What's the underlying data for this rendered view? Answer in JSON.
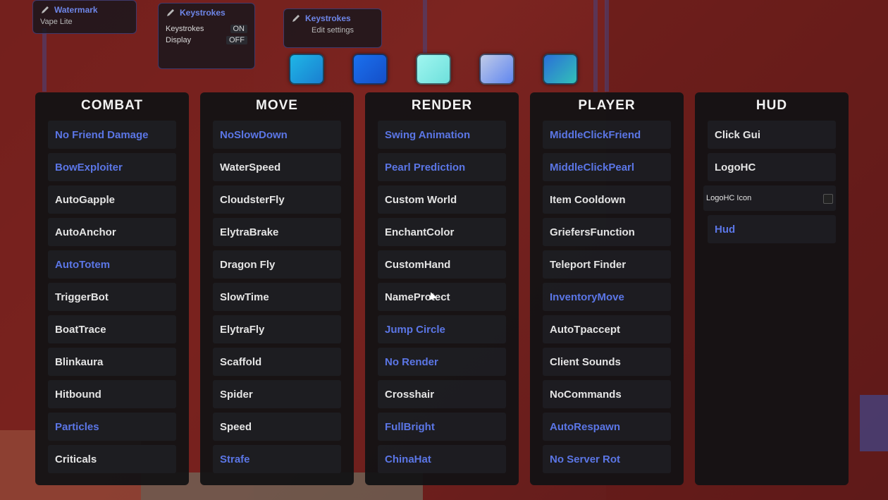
{
  "widgets": [
    {
      "title": "Watermark",
      "subtitle": "Vape Lite"
    },
    {
      "title": "Keystrokes",
      "rows": [
        {
          "label": "Keystrokes",
          "value": "ON"
        },
        {
          "label": "Display",
          "value": "OFF"
        }
      ]
    },
    {
      "title": "Keystrokes",
      "subtitle": "Edit settings"
    }
  ],
  "swatches": [
    {
      "name": "cyan-blue",
      "color": "#1f9fd9"
    },
    {
      "name": "blue",
      "color": "#1a5fe0"
    },
    {
      "name": "aqua",
      "color": "#8ff0ea"
    },
    {
      "name": "periwinkle",
      "color": "#7f9ff0"
    },
    {
      "name": "teal-blue",
      "color": "#2a8fc8"
    }
  ],
  "panels": [
    {
      "title": "COMBAT",
      "modules": [
        {
          "label": "No Friend Damage",
          "on": true
        },
        {
          "label": "BowExploiter",
          "on": true
        },
        {
          "label": "AutoGapple",
          "on": false
        },
        {
          "label": "AutoAnchor",
          "on": false
        },
        {
          "label": "AutoTotem",
          "on": true
        },
        {
          "label": "TriggerBot",
          "on": false
        },
        {
          "label": "BoatTrace",
          "on": false
        },
        {
          "label": "Blinkaura",
          "on": false
        },
        {
          "label": "Hitbound",
          "on": false
        },
        {
          "label": "Particles",
          "on": true
        },
        {
          "label": "Criticals",
          "on": false
        }
      ]
    },
    {
      "title": "MOVE",
      "modules": [
        {
          "label": "NoSlowDown",
          "on": true
        },
        {
          "label": "WaterSpeed",
          "on": false
        },
        {
          "label": "CloudsterFly",
          "on": false
        },
        {
          "label": "ElytraBrake",
          "on": false
        },
        {
          "label": "Dragon Fly",
          "on": false
        },
        {
          "label": "SlowTime",
          "on": false
        },
        {
          "label": "ElytraFly",
          "on": false
        },
        {
          "label": "Scaffold",
          "on": false
        },
        {
          "label": "Spider",
          "on": false
        },
        {
          "label": "Speed",
          "on": false
        },
        {
          "label": "Strafe",
          "on": true
        }
      ]
    },
    {
      "title": "RENDER",
      "modules": [
        {
          "label": "Swing Animation",
          "on": true
        },
        {
          "label": "Pearl Prediction",
          "on": true
        },
        {
          "label": "Custom World",
          "on": false
        },
        {
          "label": "EnchantColor",
          "on": false
        },
        {
          "label": "CustomHand",
          "on": false
        },
        {
          "label": "NameProtect",
          "on": false
        },
        {
          "label": "Jump Circle",
          "on": true
        },
        {
          "label": "No Render",
          "on": true
        },
        {
          "label": "Crosshair",
          "on": false
        },
        {
          "label": "FullBright",
          "on": true
        },
        {
          "label": "ChinaHat",
          "on": true
        }
      ]
    },
    {
      "title": "PLAYER",
      "modules": [
        {
          "label": "MiddleClickFriend",
          "on": true
        },
        {
          "label": "MiddleClickPearl",
          "on": true
        },
        {
          "label": "Item Cooldown",
          "on": false
        },
        {
          "label": "GriefersFunction",
          "on": false
        },
        {
          "label": "Teleport Finder",
          "on": false
        },
        {
          "label": "InventoryMove",
          "on": true
        },
        {
          "label": "AutoTpaccept",
          "on": false
        },
        {
          "label": "Client Sounds",
          "on": false
        },
        {
          "label": "NoCommands",
          "on": false
        },
        {
          "label": "AutoRespawn",
          "on": true
        },
        {
          "label": "No Server Rot",
          "on": true
        }
      ]
    },
    {
      "title": "HUD",
      "modules": [
        {
          "label": "Click Gui",
          "on": false
        },
        {
          "label": "LogoHC",
          "on": false
        },
        {
          "label": "LogoHC Icon",
          "on": false,
          "small": true
        },
        {
          "label": "Hud",
          "on": true
        }
      ]
    }
  ]
}
